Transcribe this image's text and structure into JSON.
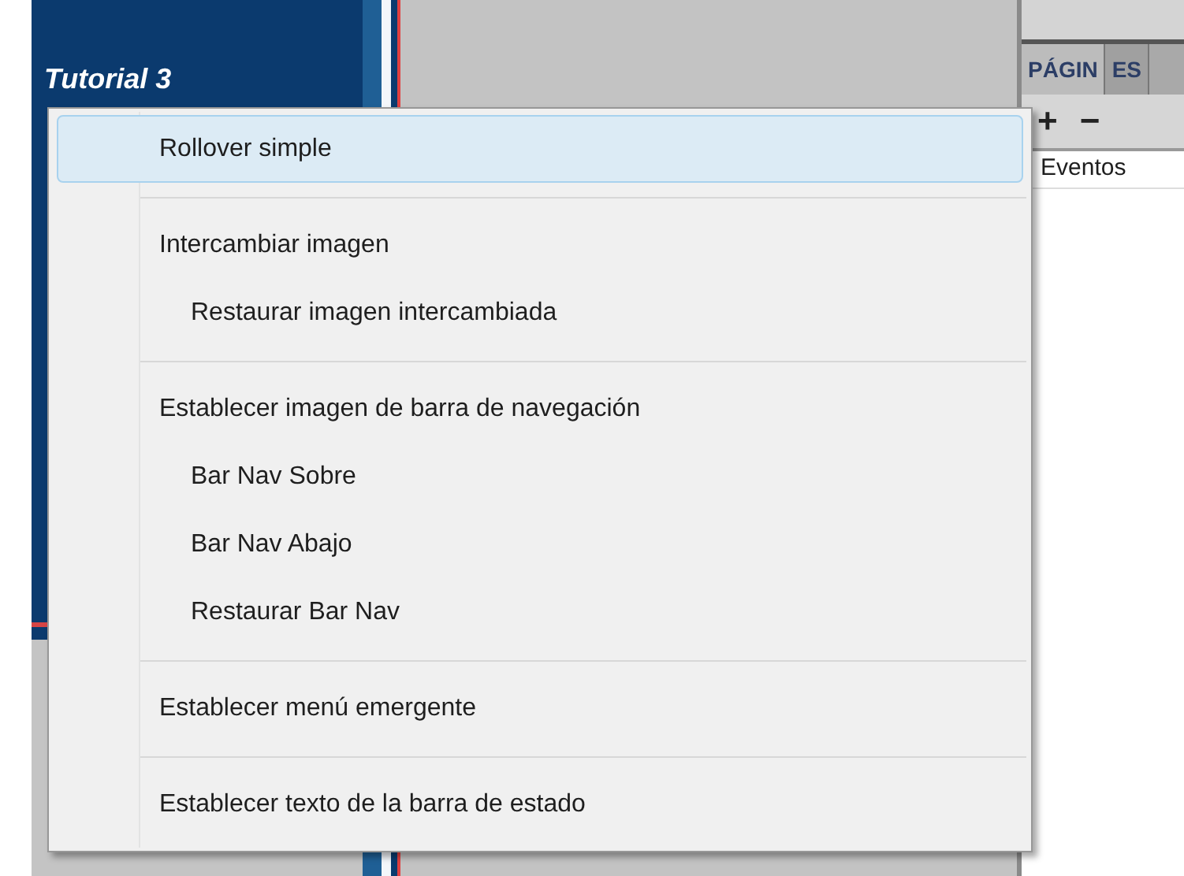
{
  "sidebar": {
    "items": [
      {
        "label": "Tutorial 3"
      }
    ]
  },
  "panel": {
    "tabs": [
      {
        "label": "PÁGIN",
        "selected": true
      },
      {
        "label": "ES",
        "selected": false
      }
    ],
    "toolbar": [
      "+",
      "−"
    ],
    "rows": [
      "Eventos"
    ]
  },
  "context_menu": {
    "groups": [
      {
        "items": [
          {
            "label": "Rollover simple",
            "selected": true
          }
        ]
      },
      {
        "items": [
          {
            "label": "Intercambiar imagen",
            "selected": false,
            "children": [
              {
                "label": "Restaurar imagen intercambiada",
                "selected": false
              }
            ]
          }
        ]
      },
      {
        "items": [
          {
            "label": "Establecer imagen de barra de navegación",
            "selected": false,
            "children": [
              {
                "label": "Bar Nav Sobre",
                "selected": false
              },
              {
                "label": "Bar Nav Abajo",
                "selected": false
              },
              {
                "label": "Restaurar Bar Nav",
                "selected": false
              }
            ]
          }
        ]
      },
      {
        "items": [
          {
            "label": "Establecer menú emergente",
            "selected": false
          }
        ]
      },
      {
        "items": [
          {
            "label": "Establecer texto de la barra de estado",
            "selected": false
          }
        ]
      }
    ]
  }
}
